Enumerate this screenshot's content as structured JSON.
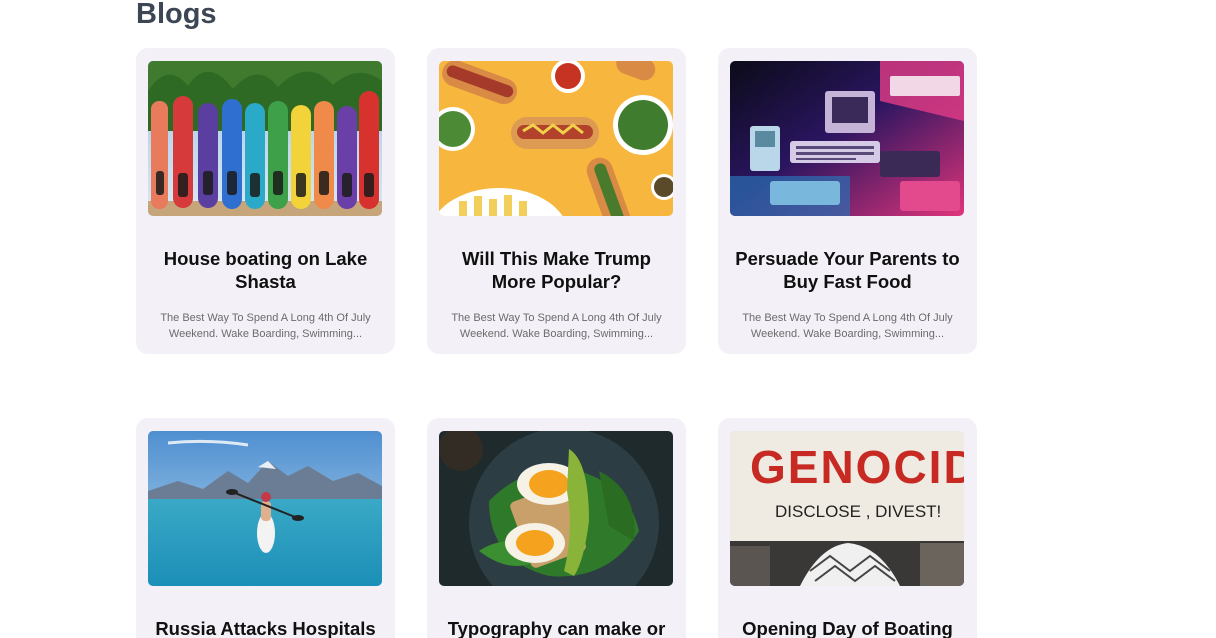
{
  "section": {
    "heading": "Blogs"
  },
  "posts": [
    {
      "title": "House boating on Lake Shasta",
      "excerpt": "The Best Way To Spend A Long 4th Of July Weekend. Wake Boarding, Swimming...",
      "image": "surfboards-photo"
    },
    {
      "title": "Will This Make Trump More Popular?",
      "excerpt": "The Best Way To Spend A Long 4th Of July Weekend. Wake Boarding, Swimming...",
      "image": "hotdogs-photo"
    },
    {
      "title": "Persuade Your Parents to Buy Fast Food",
      "excerpt": "The Best Way To Spend A Long 4th Of July Weekend. Wake Boarding, Swimming...",
      "image": "retro-computers-photo"
    },
    {
      "title": "Russia Attacks Hospitals",
      "image": "kayak-lake-photo"
    },
    {
      "title": "Typography can make or",
      "image": "egg-toast-photo"
    },
    {
      "title": "Opening Day of Boating",
      "image": "protest-sign-photo",
      "image_sign_text": "GENOCID",
      "image_sign_subtext": "DISCLOSE , DIVEST!"
    }
  ]
}
